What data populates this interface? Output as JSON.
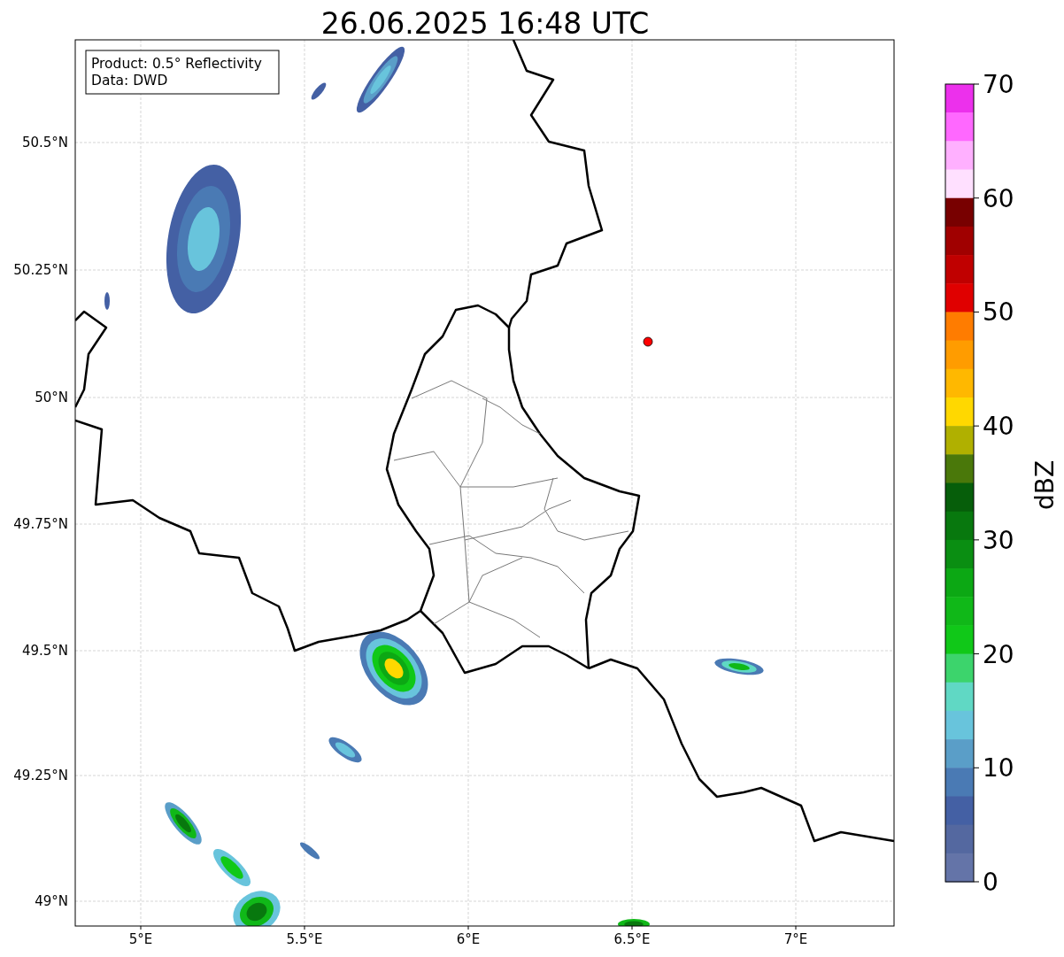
{
  "title": "26.06.2025 16:48 UTC",
  "legend": [
    "Product: 0.5° Reflectivity",
    "Data: DWD"
  ],
  "x_ticks": [
    "5°E",
    "5.5°E",
    "6°E",
    "6.5°E",
    "7°E"
  ],
  "y_ticks": [
    "50.5°N",
    "50.25°N",
    "50°N",
    "49.75°N",
    "49.5°N",
    "49.25°N",
    "49°N"
  ],
  "colorbar": {
    "label": "dBZ",
    "ticks": [
      "70",
      "60",
      "50",
      "40",
      "30",
      "20",
      "10",
      "0"
    ],
    "bands": [
      {
        "color": "#ec30ec"
      },
      {
        "color": "#ff68ff"
      },
      {
        "color": "#ffb0ff"
      },
      {
        "color": "#ffe0ff"
      },
      {
        "color": "#780000"
      },
      {
        "color": "#a00000"
      },
      {
        "color": "#c00000"
      },
      {
        "color": "#e00000"
      },
      {
        "color": "#ff7c00"
      },
      {
        "color": "#ff9c00"
      },
      {
        "color": "#ffb800"
      },
      {
        "color": "#ffd800"
      },
      {
        "color": "#b0b000"
      },
      {
        "color": "#4a780a"
      },
      {
        "color": "#065e0a"
      },
      {
        "color": "#08780e"
      },
      {
        "color": "#0a8e12"
      },
      {
        "color": "#0ca814"
      },
      {
        "color": "#10b818"
      },
      {
        "color": "#10c818"
      },
      {
        "color": "#3cd46c"
      },
      {
        "color": "#60d8c4"
      },
      {
        "color": "#68c4dc"
      },
      {
        "color": "#5a9ec8"
      },
      {
        "color": "#4a7ab4"
      },
      {
        "color": "#4460a4"
      },
      {
        "color": "#5468a0"
      },
      {
        "color": "#6474a8"
      }
    ]
  }
}
